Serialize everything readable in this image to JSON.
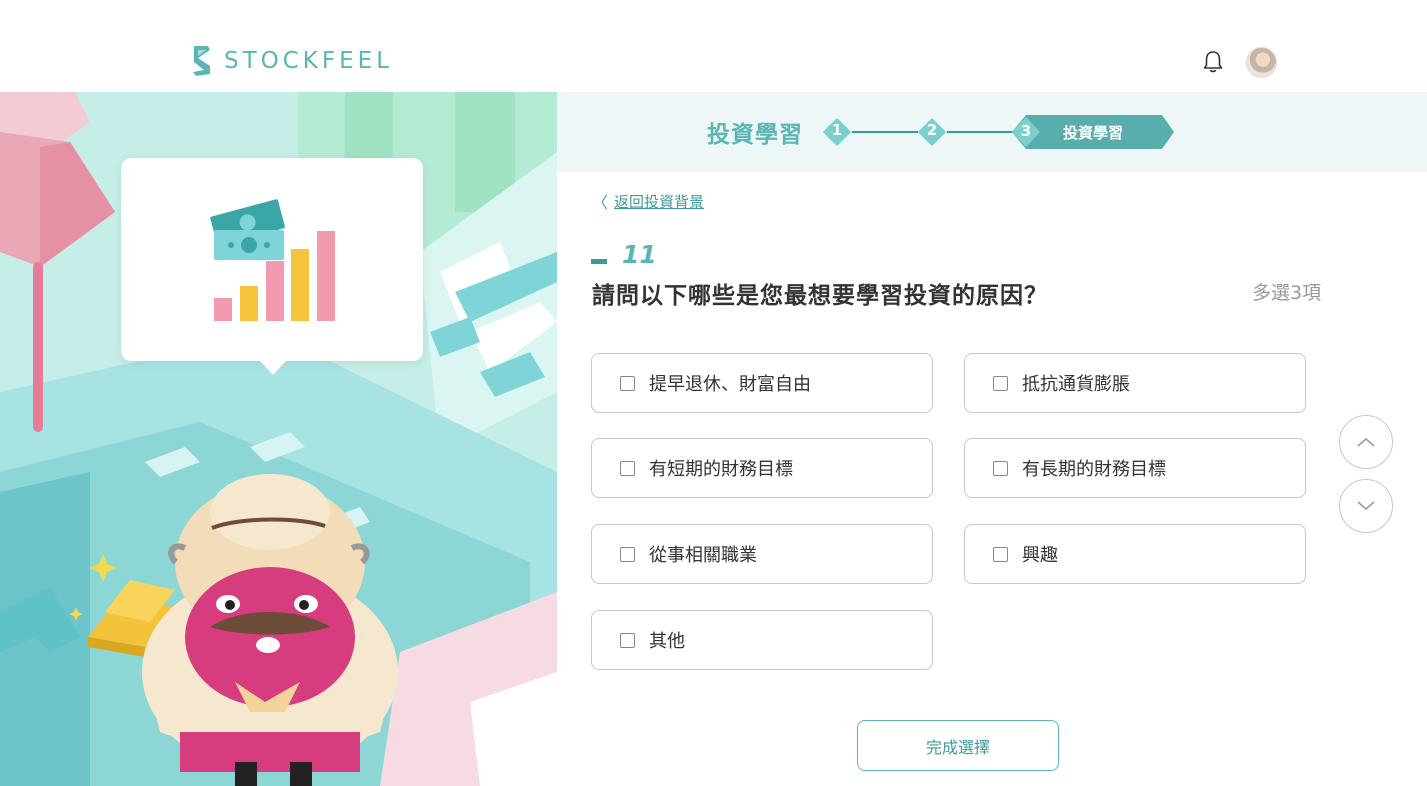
{
  "brand": {
    "name": "STOCKFEEL"
  },
  "header": {
    "bell_icon": "bell-icon",
    "avatar_icon": "user-avatar"
  },
  "progress": {
    "title": "投資學習",
    "steps": [
      {
        "num": "1"
      },
      {
        "num": "2"
      },
      {
        "num": "3",
        "label": "投資學習"
      }
    ],
    "current_step": 3
  },
  "nav": {
    "back_label": "返回投資背景",
    "back_icon": "chevron-left-icon"
  },
  "question": {
    "number": "11",
    "title": "請問以下哪些是您最想要學習投資的原因？",
    "hint": "多選3項"
  },
  "options": [
    {
      "label": "提早退休、財富自由",
      "checked": false
    },
    {
      "label": "抵抗通貨膨脹",
      "checked": false
    },
    {
      "label": "有短期的財務目標",
      "checked": false
    },
    {
      "label": "有長期的財務目標",
      "checked": false
    },
    {
      "label": "從事相關職業",
      "checked": false
    },
    {
      "label": "興趣",
      "checked": false
    },
    {
      "label": "其他",
      "checked": false
    }
  ],
  "scroll": {
    "up_icon": "chevron-up-icon",
    "down_icon": "chevron-down-icon"
  },
  "submit_label": "完成選擇",
  "colors": {
    "accent": "#5bb5b5",
    "accent_dark": "#3d9a9a",
    "progress_bg": "#eef7f8"
  }
}
